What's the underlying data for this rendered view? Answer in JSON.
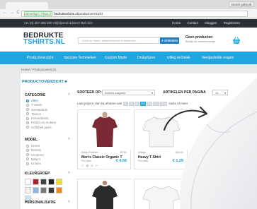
{
  "browser": {
    "window_label": "Derek gebruik",
    "secure_label": "Beveiligd | https://",
    "url_host": "bedrukteshirts.nl",
    "url_path": "/productoverzicht"
  },
  "topbar": {
    "phone": "+31 (0) 457 555 500   Vrijblijvend advies? Bel ons!",
    "links": [
      "Home",
      "Contact",
      "Inloggen",
      "Registreren"
    ]
  },
  "header": {
    "logo_line1": "BEDRUKTE",
    "logo_line2": "TSHIRTS.NL",
    "search_placeholder": "Zoek op naam, artikelnummer of trefwoord...",
    "search_button": "ZOEKEN",
    "delivery_title": "Geen producten",
    "delivery_sub": "Bekijk uw winkelmandje",
    "basket_icon": "basket-icon"
  },
  "menu": [
    "Productoverzicht",
    "Speciale Technieken",
    "Custom Made",
    "Drukprijzen",
    "Uitleg techniek",
    "Veelgestelde vragen"
  ],
  "breadcrumb": "Home  /  Productoverzicht",
  "page_title": "PRODUCTOVERZICHT",
  "sidebar": {
    "category_title": "CATEGORIE",
    "categories": [
      "Alles",
      "T-Shirts",
      "Sweatshirts",
      "Tassen",
      "Polos/tshirts",
      "Petten en mutsen",
      "Softshell jacks"
    ],
    "model_title": "MODEL",
    "models": [
      "Heren",
      "Dames",
      "Kinderen",
      "Baby's",
      "Unisex"
    ],
    "color_title": "KLEURGROEP",
    "colors": [
      "#ffffff",
      "#b21f2d",
      "#444444",
      "#222222",
      "#f5dd20",
      "#f3f3f3",
      "#8fb4e3",
      "#777777",
      "#3a3a3a",
      "#f08a1c",
      "#cfe3f5"
    ],
    "personalise_title": "PERSONALISATIE"
  },
  "sortbar": {
    "sort_label": "SORTEER OP:",
    "sort_value": "Sorteer volgorde",
    "per_page_label": "ARTIKELEN PER PAGINA",
    "per_page_value": "12",
    "prices_prefix": "Laat prijzen zien bij afname van",
    "price_steps": [
      "10",
      "25",
      "50",
      "100",
      "250",
      "500",
      "1000"
    ],
    "active_step": "100",
    "prices_suffix": "stuks of meer"
  },
  "products": [
    {
      "brand": "Earth Positive",
      "code": "EP01",
      "name": "Men's Classic Organic T",
      "per": "Per stuk",
      "price": "€ 4,56",
      "color": "#7b2a33"
    },
    {
      "brand": "Gildan",
      "code": "180.01",
      "name": "Heavy T-Shirt",
      "per": "Per stuk",
      "price": "€ 1,29",
      "color": "#f2f2f2"
    }
  ]
}
